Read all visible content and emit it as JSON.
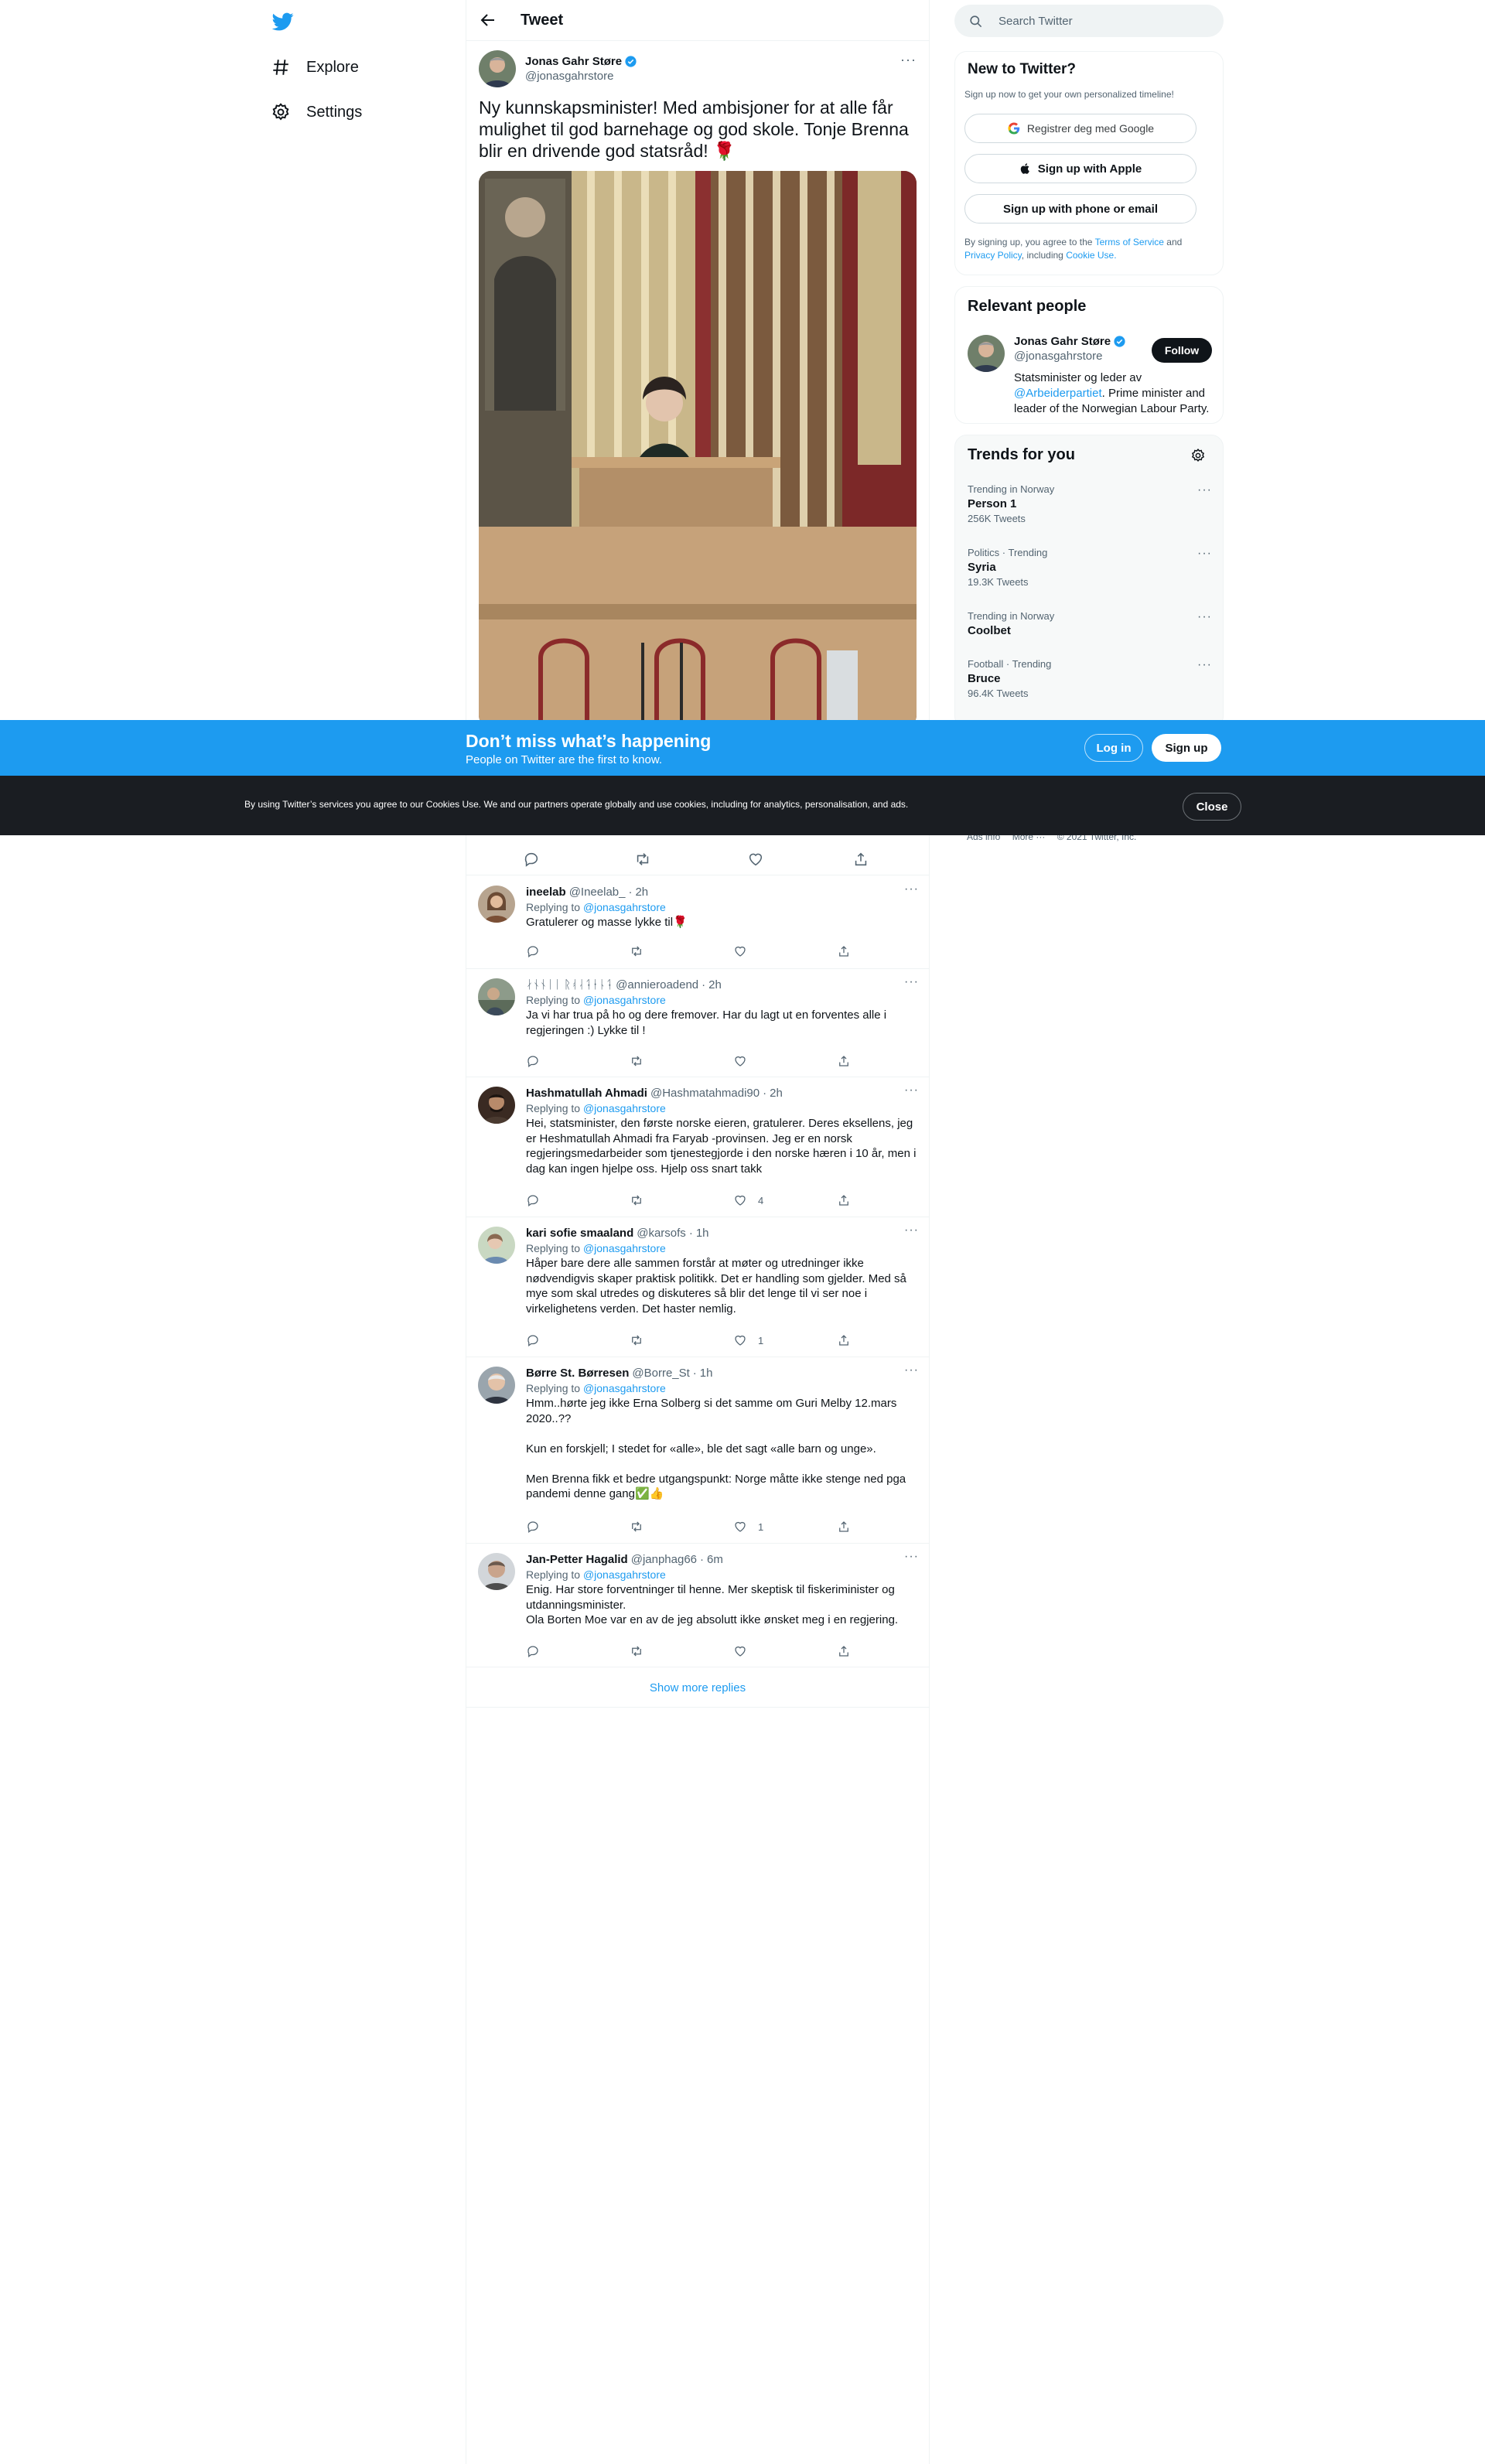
{
  "colors": {
    "accent": "#1d9bf0",
    "text": "#0f1419",
    "muted": "#536471",
    "banner": "#1d9bf0",
    "cookie_bar": "#1a1d22"
  },
  "nav": {
    "logo_icon": "twitter-bird-icon",
    "items": [
      {
        "label": "Explore",
        "icon": "hashtag-icon"
      },
      {
        "label": "Settings",
        "icon": "gear-icon"
      }
    ]
  },
  "header": {
    "title": "Tweet",
    "back_icon": "arrow-left-icon"
  },
  "tweet": {
    "author_name": "Jonas Gahr Støre",
    "author_handle": "@jonasgahrstore",
    "text": "Ny kunnskapsminister! Med ambisjoner for at alle får mulighet til god barnehage og god skole. Tonje Brenna blir en drivende god statsråd! 🌹"
  },
  "replies": [
    {
      "name": "ineelab",
      "handle": "@Ineelab_",
      "time": "2h",
      "replying_label": "Replying to",
      "replying_to": "@jonasgahrstore",
      "text": "Gratulerer og masse lykke til🌹",
      "likes": ""
    },
    {
      "name": "ᛅᚾᚾᛁᛁ ᚱᚮᛆᛑᛂᚿᛑ",
      "handle": "@annieroadend",
      "time": "2h",
      "replying_label": "Replying to",
      "replying_to": "@jonasgahrstore",
      "text": "Ja vi har trua på ho og dere fremover. Har du lagt ut en forventes alle i regjeringen :) Lykke til !",
      "likes": ""
    },
    {
      "name": "Hashmatullah Ahmadi",
      "handle": "@Hashmatahmadi90",
      "time": "2h",
      "replying_label": "Replying to",
      "replying_to": "@jonasgahrstore",
      "text": "Hei, statsminister, den første norske eieren, gratulerer. Deres eksellens, jeg er Heshmatullah Ahmadi fra Faryab -provinsen. Jeg er en norsk regjeringsmedarbeider som tjenestegjorde i den norske hæren i 10 år, men i dag kan ingen hjelpe oss. Hjelp oss snart takk",
      "likes": "4"
    },
    {
      "name": "kari sofie smaaland",
      "handle": "@karsofs",
      "time": "1h",
      "replying_label": "Replying to",
      "replying_to": "@jonasgahrstore",
      "text": "Håper bare dere alle sammen forstår at møter og utredninger ikke nødvendigvis skaper praktisk politikk. Det er handling som gjelder. Med så mye som skal utredes og diskuteres så blir det lenge til vi ser noe i virkelighetens verden. Det haster nemlig.",
      "likes": "1"
    },
    {
      "name": "Børre St. Børresen",
      "handle": "@Borre_St",
      "time": "1h",
      "replying_label": "Replying to",
      "replying_to": "@jonasgahrstore",
      "text": "Hmm..hørte jeg ikke Erna Solberg si det samme om Guri Melby 12.mars 2020..??\n\nKun en forskjell; I stedet for «alle», ble det sagt «alle barn og unge».\n\nMen Brenna fikk et bedre utgangspunkt: Norge måtte ikke stenge ned pga pandemi denne gang✅👍",
      "likes": "1"
    },
    {
      "name": "Jan-Petter Hagalid",
      "handle": "@janphag66",
      "time": "6m",
      "replying_label": "Replying to",
      "replying_to": "@jonasgahrstore",
      "text": "Enig. Har store forventninger til henne. Mer skeptisk til fiskeriminister og utdanningsminister.\nOla Borten Moe var en av de jeg absolutt ikke ønsket meg i en regjering.",
      "likes": ""
    }
  ],
  "show_more": "Show more replies",
  "search": {
    "placeholder": "Search Twitter"
  },
  "new_to_twitter": {
    "title": "New to Twitter?",
    "subtitle": "Sign up now to get your own personalized timeline!",
    "google_btn": "Registrer deg med Google",
    "apple_btn": "Sign up with Apple",
    "phone_btn": "Sign up with phone or email",
    "legal_prefix": "By signing up, you agree to the",
    "terms": "Terms of Service",
    "and": "and",
    "privacy": "Privacy Policy",
    "including": ", including",
    "cookie": "Cookie Use."
  },
  "relevant_people": {
    "title": "Relevant people",
    "name": "Jonas Gahr Støre",
    "handle": "@jonasgahrstore",
    "follow": "Follow",
    "bio_prefix": "Statsminister og leder av",
    "bio_link": "@Arbeiderpartiet",
    "bio_suffix": ". Prime minister and leader of the Norwegian Labour Party."
  },
  "trends": {
    "title": "Trends for you",
    "items": [
      {
        "meta": "Trending in Norway",
        "name": "Person 1",
        "count": "256K Tweets"
      },
      {
        "meta": "Politics · Trending",
        "name": "Syria",
        "count": "19.3K Tweets"
      },
      {
        "meta": "Trending in Norway",
        "name": "Coolbet",
        "count": ""
      },
      {
        "meta": "Football · Trending",
        "name": "Bruce",
        "count": "96.4K Tweets"
      }
    ]
  },
  "banner": {
    "title": "Don’t miss what’s happening",
    "subtitle": "People on Twitter are the first to know.",
    "login": "Log in",
    "signup": "Sign up"
  },
  "cookie_bar": {
    "text": "By using Twitter’s services you agree to our Cookies Use. We and our partners operate globally and use cookies, including for analytics, personalisation, and ads.",
    "close": "Close"
  },
  "footer": {
    "ads": "Ads info",
    "more": "More ···",
    "copyright": "© 2021 Twitter, Inc."
  }
}
